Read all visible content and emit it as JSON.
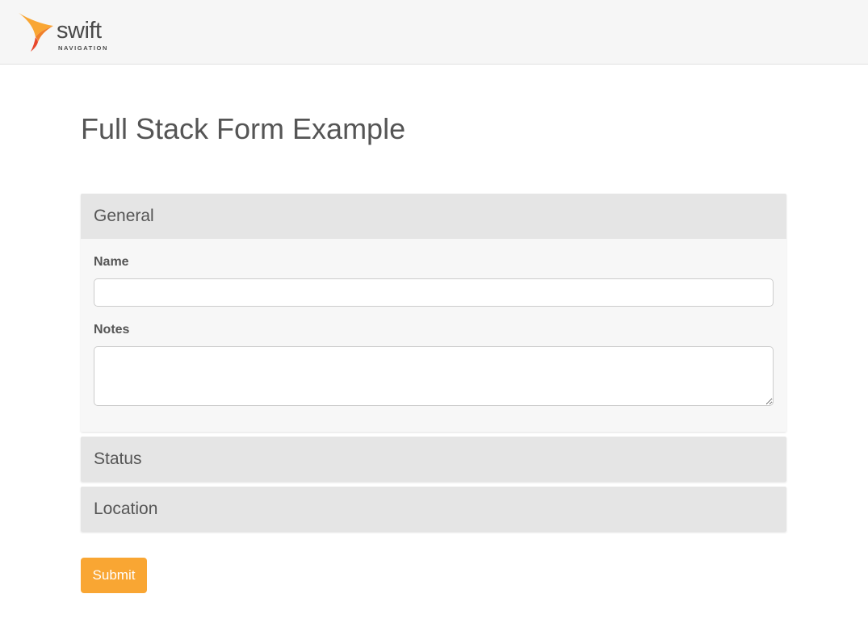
{
  "brand": {
    "name": "swift",
    "subtitle": "NAVIGATION",
    "colors": {
      "orange": "#f9a633",
      "red": "#e8472b",
      "text": "#4a4a4a"
    }
  },
  "page": {
    "title": "Full Stack Form Example"
  },
  "accordion": {
    "panels": [
      {
        "title": "General",
        "expanded": true,
        "fields": {
          "name": {
            "label": "Name",
            "value": ""
          },
          "notes": {
            "label": "Notes",
            "value": ""
          }
        }
      },
      {
        "title": "Status",
        "expanded": false
      },
      {
        "title": "Location",
        "expanded": false
      }
    ]
  },
  "actions": {
    "submit_label": "Submit",
    "submit_color": "#f9a633"
  }
}
